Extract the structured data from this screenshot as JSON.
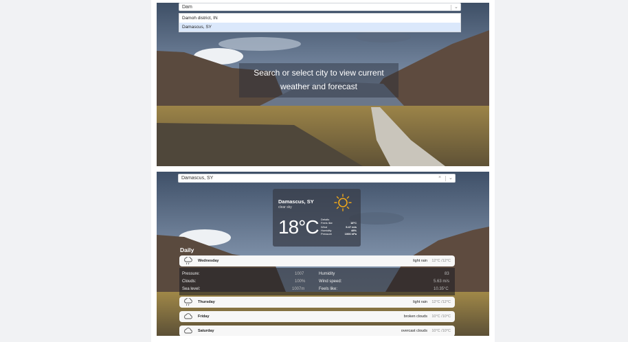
{
  "top_panel": {
    "search_value": "Dam",
    "dropdown_options": [
      "Damoh district, IN",
      "Damascus, SY"
    ],
    "prompt": "Search or select city to view current weather and forecast"
  },
  "bottom_panel": {
    "search_value": "Damascus, SY",
    "current": {
      "city": "Damascus, SY",
      "condition": "clear sky",
      "temp": "18°C",
      "details_title": "Details",
      "details": [
        {
          "label": "Feels like",
          "value": "18°C"
        },
        {
          "label": "Wind",
          "value": "5.47 m/s"
        },
        {
          "label": "Humidity",
          "value": "48%"
        },
        {
          "label": "Pressure",
          "value": "1006 hPa"
        }
      ],
      "icon": "sun-icon"
    },
    "daily_title": "Daily",
    "days": [
      {
        "day": "Wednesday",
        "desc": "light rain",
        "temps": "12°C /12°C",
        "icon": "rain-cloud-icon"
      },
      {
        "day": "Thursday",
        "desc": "light rain",
        "temps": "12°C /12°C",
        "icon": "rain-cloud-icon"
      },
      {
        "day": "Friday",
        "desc": "broken clouds",
        "temps": "10°C /10°C",
        "icon": "cloud-icon"
      },
      {
        "day": "Saturday",
        "desc": "overcast clouds",
        "temps": "10°C /10°C",
        "icon": "cloud-icon"
      }
    ],
    "expanded_details": {
      "left": [
        {
          "label": "Pressure:",
          "value": "1007"
        },
        {
          "label": "Clouds:",
          "value": "100%"
        },
        {
          "label": "Sea level:",
          "value": "1007m"
        }
      ],
      "right": [
        {
          "label": "Humidity",
          "value": "83"
        },
        {
          "label": "Wind speed:",
          "value": "5.63 m/s"
        },
        {
          "label": "Feels like:",
          "value": "10.35°C"
        }
      ]
    }
  },
  "colors": {
    "page_bg": "#f1f2f4",
    "selected_option": "#dbe8fb",
    "card_bg": "#373c46"
  }
}
